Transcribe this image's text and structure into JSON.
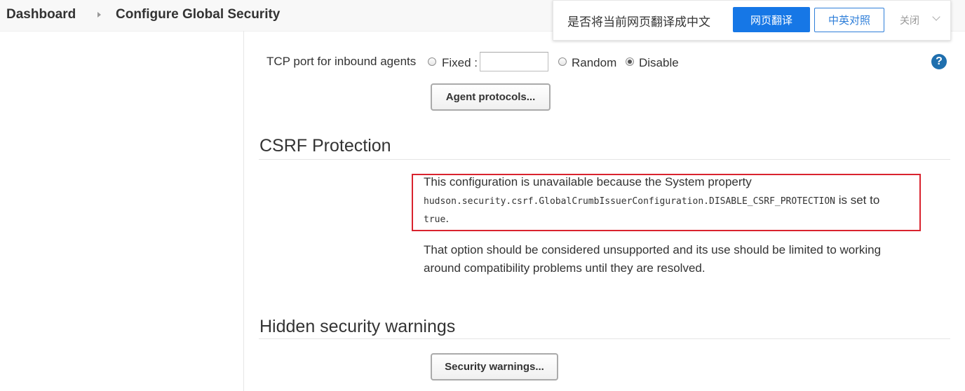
{
  "breadcrumb": {
    "items": [
      "Dashboard",
      "Configure Global Security"
    ]
  },
  "agents": {
    "tcp_label": "TCP port for inbound agents",
    "options": {
      "fixed": "Fixed :",
      "random": "Random",
      "disable": "Disable"
    },
    "selected": "Disable",
    "fixed_value": "",
    "agent_protocols_button": "Agent protocols..."
  },
  "csrf": {
    "heading": "CSRF Protection",
    "line1": "This configuration is unavailable because the System property",
    "property": "hudson.security.csrf.GlobalCrumbIssuerConfiguration.DISABLE_CSRF_PROTECTION",
    "is_set_to": " is set to",
    "value": "true",
    "value_suffix": ".",
    "note": "That option should be considered unsupported and its use should be limited to working around compatibility problems until they are resolved.",
    "border_color": "#d9232e"
  },
  "hidden_warnings": {
    "heading": "Hidden security warnings",
    "button": "Security warnings..."
  },
  "help": {
    "symbol": "?",
    "color": "#1f6fae"
  },
  "translate_bar": {
    "question": "是否将当前网页翻译成中文",
    "translate_button": "网页翻译",
    "bilingual_button": "中英对照",
    "close": "关闭",
    "accent": "#1677e6"
  }
}
